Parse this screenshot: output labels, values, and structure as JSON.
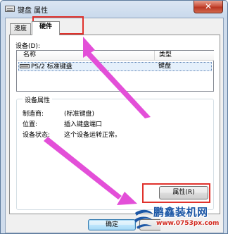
{
  "window": {
    "title": "键盘 属性",
    "close_label": "✕"
  },
  "tabs": [
    {
      "label": "速度"
    },
    {
      "label": "硬件"
    }
  ],
  "devices": {
    "label": "设备(D):",
    "columns": {
      "name": "名称",
      "type": "类型"
    },
    "rows": [
      {
        "name": "PS/2 标准键盘",
        "type": "键盘"
      }
    ]
  },
  "properties": {
    "group_title": "设备属性",
    "rows": [
      {
        "label": "制造商:",
        "value": "(标准键盘)"
      },
      {
        "label": "位置:",
        "value": "插入键盘端口"
      },
      {
        "label": "设备状态:",
        "value": "这个设备运转正常。"
      }
    ],
    "button_label": "属性(R)"
  },
  "footer": {
    "ok_label": "确定"
  },
  "watermark": {
    "title": "鹏鑫装机网",
    "url": "www.0753px.com"
  },
  "colors": {
    "highlight": "#e0322c",
    "arrow": "#e34fd8",
    "watermark_blue": "#1c57a6",
    "watermark_red": "#d12a1f"
  },
  "icons": {
    "title": "keyboard-icon",
    "device": "keyboard-icon",
    "close": "close-icon"
  }
}
